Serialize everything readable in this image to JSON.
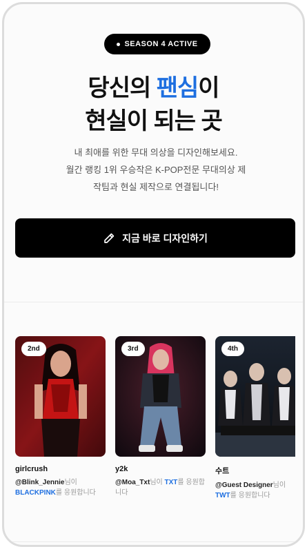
{
  "hero": {
    "badge": "SEASON 4 ACTIVE",
    "title_line1_pre": "당신의 ",
    "title_line1_accent": "팬심",
    "title_line1_post": "이",
    "title_line2": "현실이 되는 곳",
    "desc_line1": "내 최애를 위한 무대 의상을 디자인해보세요.",
    "desc_line2": "월간 랭킹 1위 우승작은 K-POP전문 무대의상 제",
    "desc_line3": "작팀과 현실 제작으로 연결됩니다!",
    "cta_label": "지금 바로 디자인하기",
    "accent_color": "#1e6fe0"
  },
  "gallery": {
    "cards": [
      {
        "rank": "2nd",
        "title": "girlcrush",
        "user": "@Blink_Jennie",
        "suffix1": "님이",
        "group": "BLACKPINK",
        "suffix2": "를 응원합니다"
      },
      {
        "rank": "3rd",
        "title": "y2k",
        "user": "@Moa_Txt",
        "suffix1": "님이 ",
        "group": "TXT",
        "suffix2": "를 응원합니다"
      },
      {
        "rank": "4th",
        "title": "수트",
        "user": "@Guest Designer",
        "suffix1": "님이",
        "group": "TWT",
        "suffix2": "를 응원합니다"
      }
    ]
  }
}
